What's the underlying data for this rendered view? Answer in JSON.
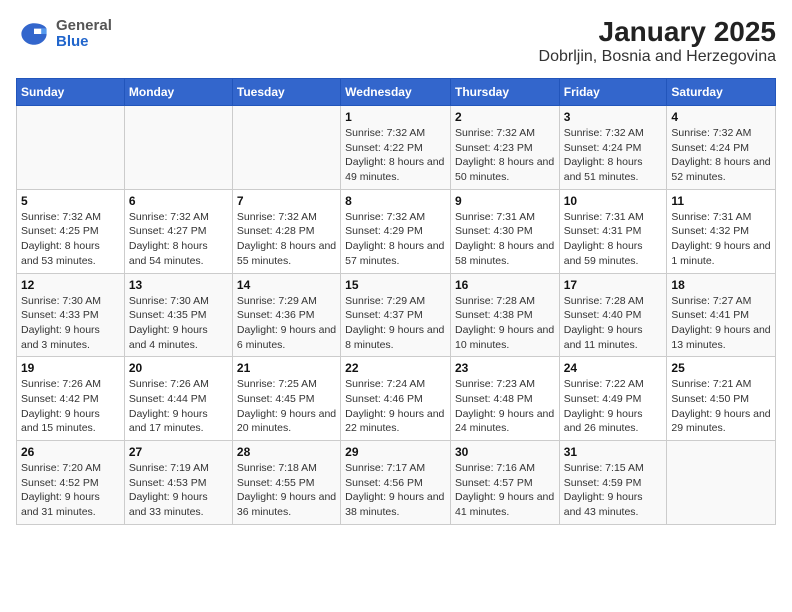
{
  "header": {
    "logo_general": "General",
    "logo_blue": "Blue",
    "title": "January 2025",
    "subtitle": "Dobrljin, Bosnia and Herzegovina"
  },
  "days_of_week": [
    "Sunday",
    "Monday",
    "Tuesday",
    "Wednesday",
    "Thursday",
    "Friday",
    "Saturday"
  ],
  "weeks": [
    [
      {
        "num": "",
        "info": ""
      },
      {
        "num": "",
        "info": ""
      },
      {
        "num": "",
        "info": ""
      },
      {
        "num": "1",
        "info": "Sunrise: 7:32 AM\nSunset: 4:22 PM\nDaylight: 8 hours and 49 minutes."
      },
      {
        "num": "2",
        "info": "Sunrise: 7:32 AM\nSunset: 4:23 PM\nDaylight: 8 hours and 50 minutes."
      },
      {
        "num": "3",
        "info": "Sunrise: 7:32 AM\nSunset: 4:24 PM\nDaylight: 8 hours and 51 minutes."
      },
      {
        "num": "4",
        "info": "Sunrise: 7:32 AM\nSunset: 4:24 PM\nDaylight: 8 hours and 52 minutes."
      }
    ],
    [
      {
        "num": "5",
        "info": "Sunrise: 7:32 AM\nSunset: 4:25 PM\nDaylight: 8 hours and 53 minutes."
      },
      {
        "num": "6",
        "info": "Sunrise: 7:32 AM\nSunset: 4:27 PM\nDaylight: 8 hours and 54 minutes."
      },
      {
        "num": "7",
        "info": "Sunrise: 7:32 AM\nSunset: 4:28 PM\nDaylight: 8 hours and 55 minutes."
      },
      {
        "num": "8",
        "info": "Sunrise: 7:32 AM\nSunset: 4:29 PM\nDaylight: 8 hours and 57 minutes."
      },
      {
        "num": "9",
        "info": "Sunrise: 7:31 AM\nSunset: 4:30 PM\nDaylight: 8 hours and 58 minutes."
      },
      {
        "num": "10",
        "info": "Sunrise: 7:31 AM\nSunset: 4:31 PM\nDaylight: 8 hours and 59 minutes."
      },
      {
        "num": "11",
        "info": "Sunrise: 7:31 AM\nSunset: 4:32 PM\nDaylight: 9 hours and 1 minute."
      }
    ],
    [
      {
        "num": "12",
        "info": "Sunrise: 7:30 AM\nSunset: 4:33 PM\nDaylight: 9 hours and 3 minutes."
      },
      {
        "num": "13",
        "info": "Sunrise: 7:30 AM\nSunset: 4:35 PM\nDaylight: 9 hours and 4 minutes."
      },
      {
        "num": "14",
        "info": "Sunrise: 7:29 AM\nSunset: 4:36 PM\nDaylight: 9 hours and 6 minutes."
      },
      {
        "num": "15",
        "info": "Sunrise: 7:29 AM\nSunset: 4:37 PM\nDaylight: 9 hours and 8 minutes."
      },
      {
        "num": "16",
        "info": "Sunrise: 7:28 AM\nSunset: 4:38 PM\nDaylight: 9 hours and 10 minutes."
      },
      {
        "num": "17",
        "info": "Sunrise: 7:28 AM\nSunset: 4:40 PM\nDaylight: 9 hours and 11 minutes."
      },
      {
        "num": "18",
        "info": "Sunrise: 7:27 AM\nSunset: 4:41 PM\nDaylight: 9 hours and 13 minutes."
      }
    ],
    [
      {
        "num": "19",
        "info": "Sunrise: 7:26 AM\nSunset: 4:42 PM\nDaylight: 9 hours and 15 minutes."
      },
      {
        "num": "20",
        "info": "Sunrise: 7:26 AM\nSunset: 4:44 PM\nDaylight: 9 hours and 17 minutes."
      },
      {
        "num": "21",
        "info": "Sunrise: 7:25 AM\nSunset: 4:45 PM\nDaylight: 9 hours and 20 minutes."
      },
      {
        "num": "22",
        "info": "Sunrise: 7:24 AM\nSunset: 4:46 PM\nDaylight: 9 hours and 22 minutes."
      },
      {
        "num": "23",
        "info": "Sunrise: 7:23 AM\nSunset: 4:48 PM\nDaylight: 9 hours and 24 minutes."
      },
      {
        "num": "24",
        "info": "Sunrise: 7:22 AM\nSunset: 4:49 PM\nDaylight: 9 hours and 26 minutes."
      },
      {
        "num": "25",
        "info": "Sunrise: 7:21 AM\nSunset: 4:50 PM\nDaylight: 9 hours and 29 minutes."
      }
    ],
    [
      {
        "num": "26",
        "info": "Sunrise: 7:20 AM\nSunset: 4:52 PM\nDaylight: 9 hours and 31 minutes."
      },
      {
        "num": "27",
        "info": "Sunrise: 7:19 AM\nSunset: 4:53 PM\nDaylight: 9 hours and 33 minutes."
      },
      {
        "num": "28",
        "info": "Sunrise: 7:18 AM\nSunset: 4:55 PM\nDaylight: 9 hours and 36 minutes."
      },
      {
        "num": "29",
        "info": "Sunrise: 7:17 AM\nSunset: 4:56 PM\nDaylight: 9 hours and 38 minutes."
      },
      {
        "num": "30",
        "info": "Sunrise: 7:16 AM\nSunset: 4:57 PM\nDaylight: 9 hours and 41 minutes."
      },
      {
        "num": "31",
        "info": "Sunrise: 7:15 AM\nSunset: 4:59 PM\nDaylight: 9 hours and 43 minutes."
      },
      {
        "num": "",
        "info": ""
      }
    ]
  ]
}
